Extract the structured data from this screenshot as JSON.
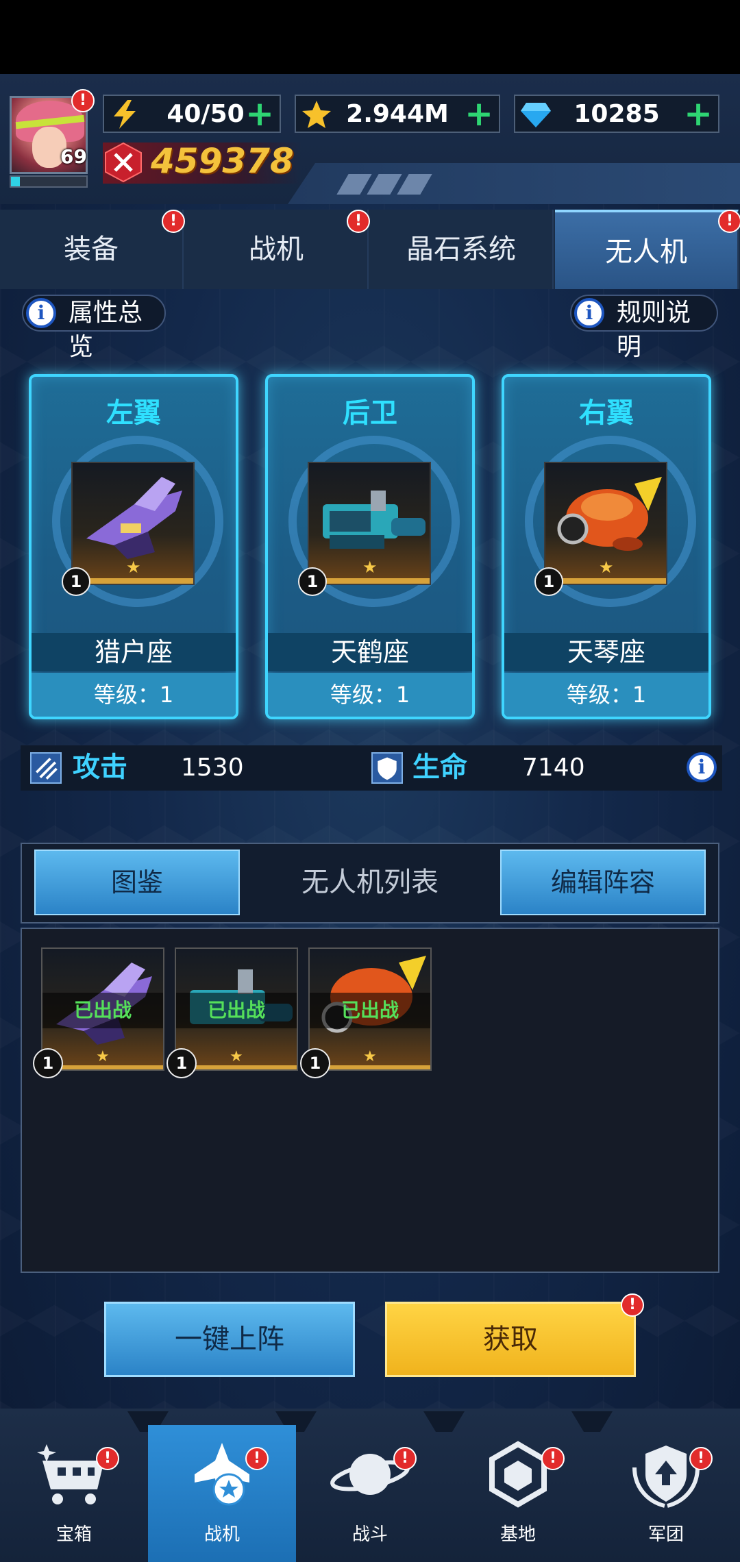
{
  "header": {
    "avatar_level": "69",
    "xp_fraction": 0.12,
    "energy": "40/50",
    "stars": "2.944M",
    "gems": "10285",
    "power": "459378",
    "alert_mark": "!"
  },
  "tabs": [
    {
      "label": "装备",
      "alert": true
    },
    {
      "label": "战机",
      "alert": true
    },
    {
      "label": "晶石系统",
      "alert": false
    },
    {
      "label": "无人机",
      "alert": true,
      "active": true
    }
  ],
  "info_pills": {
    "attributes": "属性总览",
    "rules": "规则说明",
    "info_glyph": "i"
  },
  "slots": [
    {
      "position": "左翼",
      "name": "猎户座",
      "level_text": "等级：1",
      "badge": "1",
      "stars": 1,
      "icon": "purple-jet-drone"
    },
    {
      "position": "后卫",
      "name": "天鹤座",
      "level_text": "等级：1",
      "badge": "1",
      "stars": 1,
      "icon": "teal-cannon-drone"
    },
    {
      "position": "右翼",
      "name": "天琴座",
      "level_text": "等级：1",
      "badge": "1",
      "stars": 1,
      "icon": "orange-pod-drone"
    }
  ],
  "stats": {
    "attack_label": "攻击",
    "attack_value": "1530",
    "hp_label": "生命",
    "hp_value": "7140"
  },
  "list": {
    "codex_button": "图鉴",
    "title": "无人机列表",
    "edit_button": "编辑阵容",
    "items": [
      {
        "status": "已出战",
        "badge": "1",
        "stars": 1,
        "icon": "purple-jet-drone"
      },
      {
        "status": "已出战",
        "badge": "1",
        "stars": 1,
        "icon": "teal-cannon-drone"
      },
      {
        "status": "已出战",
        "badge": "1",
        "stars": 1,
        "icon": "orange-pod-drone"
      }
    ]
  },
  "actions": {
    "auto_deploy": "一键上阵",
    "obtain": "获取"
  },
  "nav": [
    {
      "label": "宝箱",
      "icon": "shopping-cart-icon",
      "alert": true
    },
    {
      "label": "战机",
      "icon": "fighter-jet-icon",
      "alert": true,
      "active": true
    },
    {
      "label": "战斗",
      "icon": "planet-icon",
      "alert": true
    },
    {
      "label": "基地",
      "icon": "hexagon-base-icon",
      "alert": true
    },
    {
      "label": "军团",
      "icon": "legion-shield-icon",
      "alert": true
    }
  ],
  "colors": {
    "accent_cyan": "#3fd6ff",
    "alert_red": "#e22b2b",
    "gold": "#f4c23c",
    "plus_green": "#2ed573",
    "deployed_green": "#55e05a"
  }
}
